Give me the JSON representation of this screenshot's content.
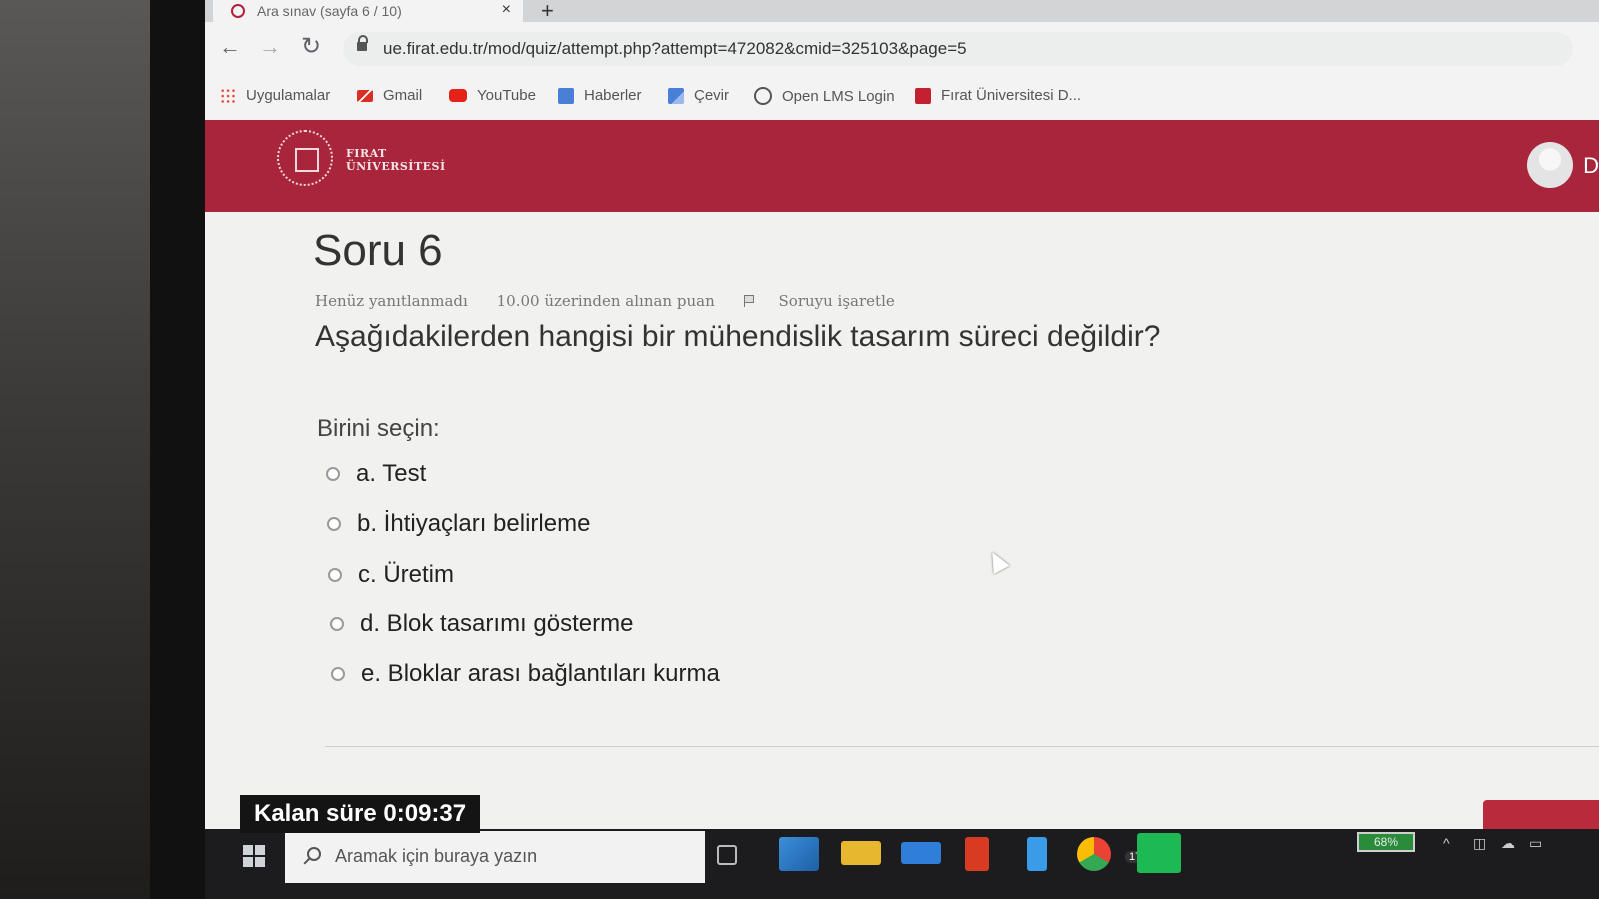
{
  "browser": {
    "tab_title": "Ara sınav (sayfa 6 / 10)",
    "tab_close": "×",
    "new_tab": "+",
    "back": "←",
    "forward": "→",
    "reload": "↻",
    "url": "ue.firat.edu.tr/mod/quiz/attempt.php?attempt=472082&cmid=325103&page=5",
    "bookmarks": [
      {
        "label": "Uygulamalar",
        "icon": "apps-grid-icon",
        "color": "#e94235"
      },
      {
        "label": "Gmail",
        "icon": "gmail-icon",
        "color": "#d93025"
      },
      {
        "label": "YouTube",
        "icon": "youtube-icon",
        "color": "#e62117"
      },
      {
        "label": "Haberler",
        "icon": "news-icon",
        "color": "#4a7fd8"
      },
      {
        "label": "Çevir",
        "icon": "translate-icon",
        "color": "#4a7fd8"
      },
      {
        "label": "Open LMS Login",
        "icon": "globe-icon",
        "color": "#555555"
      },
      {
        "label": "Fırat Üniversitesi D...",
        "icon": "firat-icon",
        "color": "#c4202f"
      }
    ]
  },
  "site": {
    "logo_line1": "FIRAT",
    "logo_line2": "ÜNİVERSİTESİ",
    "user_initial": "D",
    "accent_color": "#a8253c"
  },
  "question": {
    "title": "Soru 6",
    "status": "Henüz yanıtlanmadı",
    "points": "10.00 üzerinden alınan puan",
    "flag_label": "Soruyu işaretle",
    "text": "Aşağıdakilerden hangisi bir mühendislik tasarım süreci değildir?",
    "prompt": "Birini seçin:",
    "answers": [
      "a. Test",
      "b. İhtiyaçları belirleme",
      "c. Üretim",
      "d. Blok tasarımı gösterme",
      "e. Bloklar arası bağlantıları kurma"
    ]
  },
  "timer": "Kalan süre 0:09:37",
  "taskbar": {
    "search_placeholder": "Aramak için buraya yazın",
    "mail_badge": "17",
    "battery": "68%"
  }
}
